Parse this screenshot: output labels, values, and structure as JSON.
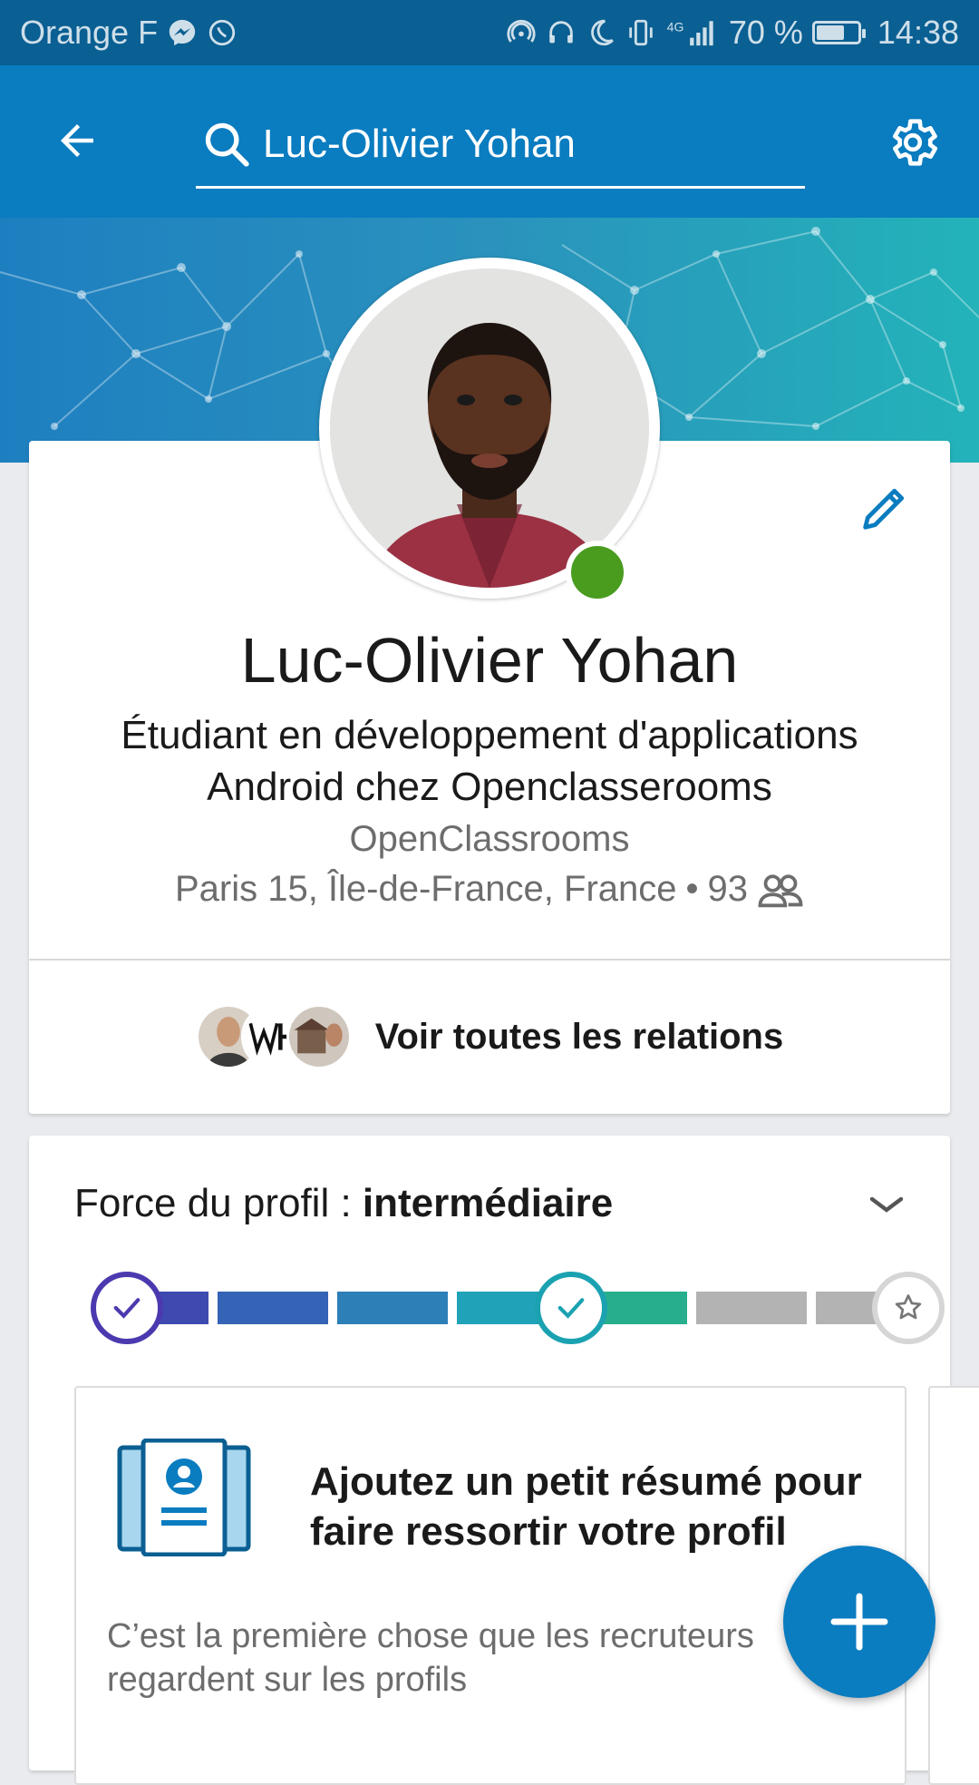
{
  "status_bar": {
    "carrier": "Orange F",
    "network": "4G",
    "battery": "70 %",
    "battery_level": 0.7,
    "time": "14:38"
  },
  "app_bar": {
    "search_value": "Luc-Olivier Yohan",
    "back_icon": "arrow-back-icon",
    "settings_icon": "gear-icon"
  },
  "profile": {
    "name": "Luc-Olivier Yohan",
    "headline": "Étudiant en développement d'applications Android chez Openclasserooms",
    "company": "OpenClassrooms",
    "location": "Paris 15, Île-de-France, France",
    "connections_prefix": "•",
    "connections_count": "93",
    "online": true
  },
  "relations": {
    "label": "Voir toutes les relations"
  },
  "profile_strength": {
    "label": "Force du profil : ",
    "level": "intermédiaire"
  },
  "suggestion": {
    "title": "Ajoutez un petit résumé pour faire ressortir votre profil",
    "description": "C’est la première chose que les recruteurs regardent sur les profils"
  },
  "colors": {
    "brand_blue": "#0a7cc0",
    "status_bar": "#0a5f93",
    "online_green": "#4a9c1f"
  }
}
